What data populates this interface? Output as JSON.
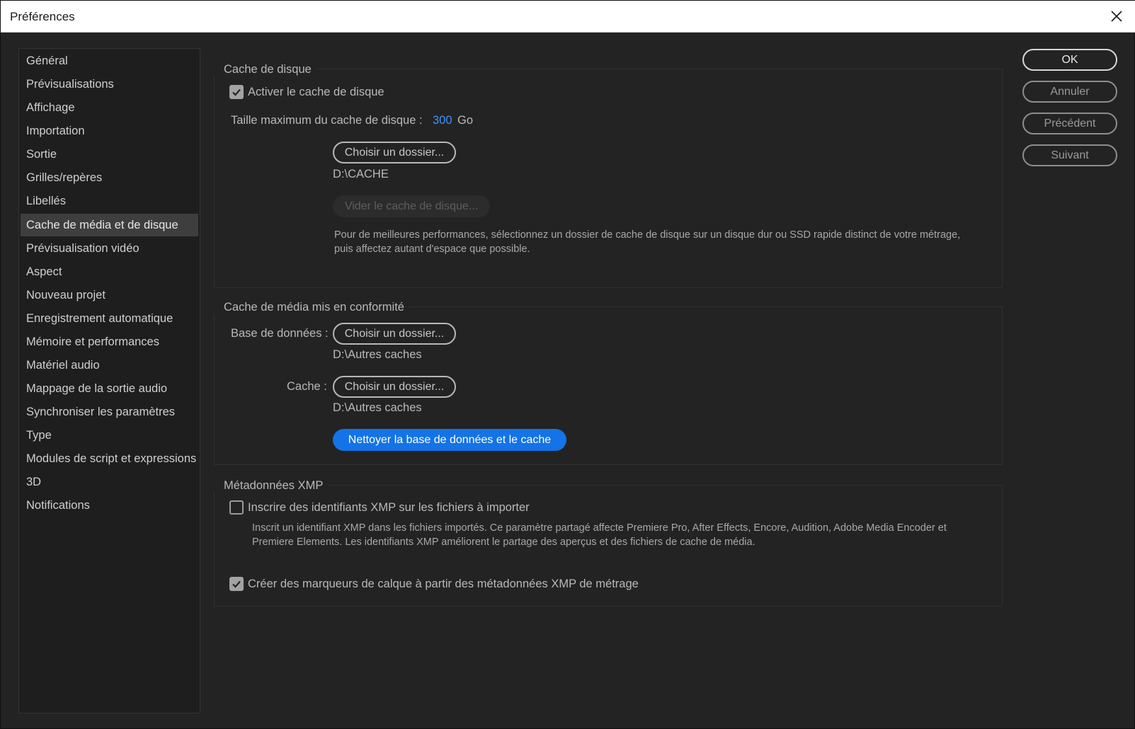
{
  "window": {
    "title": "Préférences",
    "close_icon": "close-icon"
  },
  "sidebar": {
    "items": [
      {
        "label": "Général"
      },
      {
        "label": "Prévisualisations"
      },
      {
        "label": "Affichage"
      },
      {
        "label": "Importation"
      },
      {
        "label": "Sortie"
      },
      {
        "label": "Grilles/repères"
      },
      {
        "label": "Libellés"
      },
      {
        "label": "Cache de média et de disque",
        "active": true
      },
      {
        "label": "Prévisualisation vidéo"
      },
      {
        "label": "Aspect"
      },
      {
        "label": "Nouveau projet"
      },
      {
        "label": "Enregistrement automatique"
      },
      {
        "label": "Mémoire et performances"
      },
      {
        "label": "Matériel audio"
      },
      {
        "label": "Mappage de la sortie audio"
      },
      {
        "label": "Synchroniser les paramètres"
      },
      {
        "label": "Type"
      },
      {
        "label": "Modules de script et expressions"
      },
      {
        "label": "3D"
      },
      {
        "label": "Notifications"
      }
    ]
  },
  "disk_cache": {
    "title": "Cache de disque",
    "enable_label": "Activer le cache de disque",
    "enable_checked": true,
    "max_size_label": "Taille maximum du cache de disque :",
    "max_size_value": "300",
    "max_size_unit": "Go",
    "choose_folder_label": "Choisir un dossier...",
    "folder_path": "D:\\CACHE",
    "empty_cache_label": "Vider le cache de disque...",
    "hint": "Pour de meilleures performances, sélectionnez un dossier de cache de disque sur un disque dur ou SSD rapide distinct de votre métrage, puis affectez autant d'espace que possible."
  },
  "conformed_cache": {
    "title": "Cache de média mis en conformité",
    "database_label": "Base de données :",
    "database_button": "Choisir un dossier...",
    "database_path": "D:\\Autres caches",
    "cache_label": "Cache :",
    "cache_button": "Choisir un dossier...",
    "cache_path": "D:\\Autres caches",
    "clean_button": "Nettoyer la base de données et le cache"
  },
  "xmp": {
    "title": "Métadonnées XMP",
    "write_ids_label": "Inscrire des identifiants XMP sur les fichiers à importer",
    "write_ids_checked": false,
    "write_ids_hint": "Inscrit un identifiant XMP dans les fichiers importés. Ce paramètre partagé affecte Premiere Pro, After Effects, Encore, Audition, Adobe Media Encoder et Premiere Elements. Les identifiants XMP améliorent le partage des aperçus et des fichiers de cache de média.",
    "layer_markers_label": "Créer des marqueurs de calque à partir des métadonnées XMP de métrage",
    "layer_markers_checked": true
  },
  "actions": {
    "ok": "OK",
    "cancel": "Annuler",
    "previous": "Précédent",
    "next": "Suivant"
  },
  "colors": {
    "accent": "#1473e6",
    "value_blue": "#3b94ff",
    "background": "#232323"
  }
}
